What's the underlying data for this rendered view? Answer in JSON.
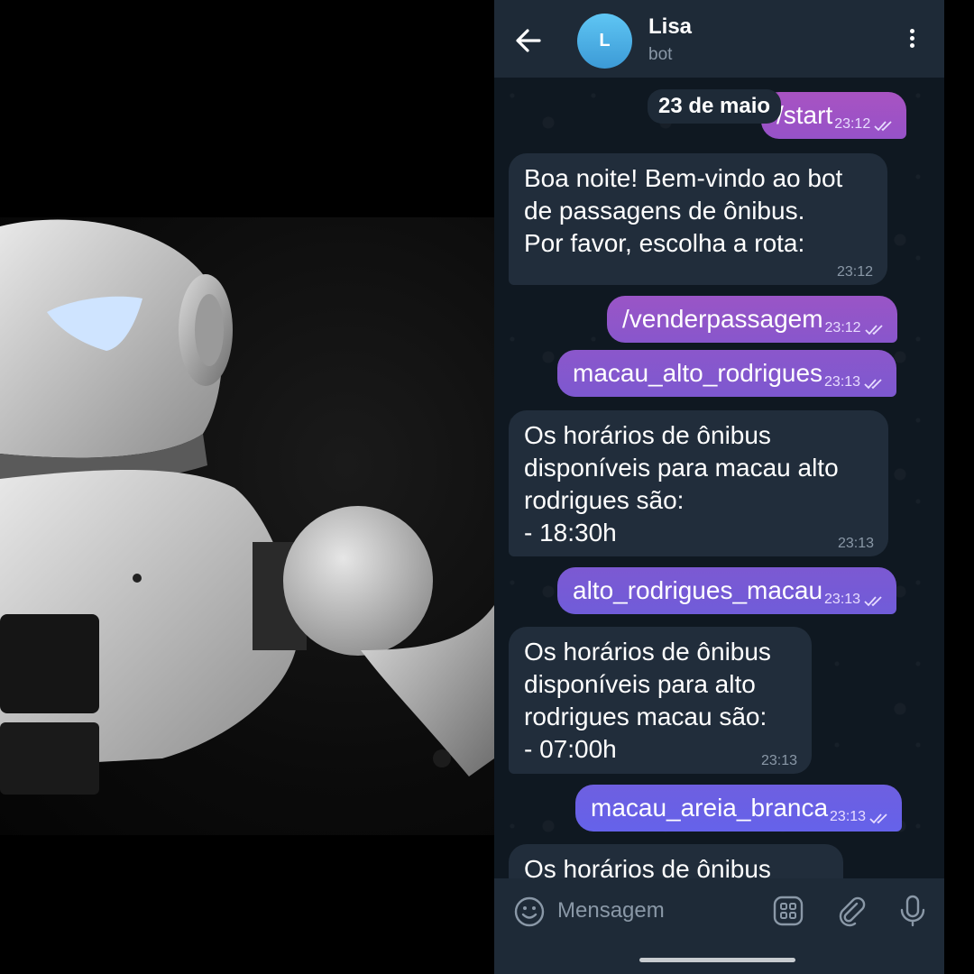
{
  "header": {
    "avatar_letter": "L",
    "title": "Lisa",
    "subtitle": "bot"
  },
  "chat": {
    "date_chip": "23 de maio",
    "messages": [
      {
        "dir": "out",
        "text": "/start",
        "time": "23:12"
      },
      {
        "dir": "in",
        "text": "Boa noite! Bem-vindo ao bot\nde passagens de ônibus.\nPor favor, escolha a rota:",
        "time": "23:12"
      },
      {
        "dir": "out",
        "text": "/venderpassagem",
        "time": "23:12"
      },
      {
        "dir": "out",
        "text": "macau_alto_rodrigues",
        "time": "23:13"
      },
      {
        "dir": "in",
        "text": "Os horários de ônibus\ndisponíveis para macau alto\nrodrigues são:\n- 18:30h",
        "time": "23:13"
      },
      {
        "dir": "out",
        "text": "alto_rodrigues_macau",
        "time": "23:13"
      },
      {
        "dir": "in",
        "text": "Os horários de ônibus\ndisponíveis para alto\nrodrigues macau são:\n- 07:00h",
        "time": "23:13"
      },
      {
        "dir": "out",
        "text": "macau_areia_branca",
        "time": "23:13"
      },
      {
        "dir": "in",
        "text": "Os horários de ônibus",
        "time": ""
      }
    ]
  },
  "composer": {
    "placeholder": "Mensagem"
  },
  "colors": {
    "header_bg": "#1e2a37",
    "chat_bg": "#0f1821",
    "incoming_bubble": "#212d3b",
    "outgoing_gradient_top": "#a24dc0",
    "outgoing_gradient_bottom": "#6a5ff0"
  },
  "icons": {
    "back": "arrow-left-icon",
    "menu": "kebab-menu-icon",
    "emoji": "smiley-icon",
    "commands": "grid-icon",
    "attach": "paperclip-icon",
    "voice": "microphone-icon",
    "read": "double-check-icon"
  }
}
